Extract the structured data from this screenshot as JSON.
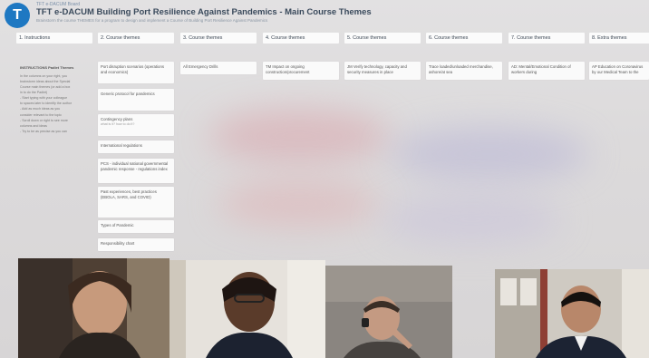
{
  "board": {
    "meta_line": "TFT e-DACUM Board",
    "title": "TFT e-DACUM Building Port Resilience Against Pandemics - Main Course Themes",
    "subtitle": "Brainstorm the course THEMES for a program to design and implement a Course of Building Port Resilience Against Pandemics"
  },
  "columns": [
    {
      "label": "1. Instructions"
    },
    {
      "label": "2. Course themes"
    },
    {
      "label": "3. Course themes"
    },
    {
      "label": "4. Course themes"
    },
    {
      "label": "5. Course themes"
    },
    {
      "label": "6. Course themes"
    },
    {
      "label": "7. Course themes"
    },
    {
      "label": "8. Extra themes"
    }
  ],
  "instructions": {
    "heading": "INSTRUCTIONS Padlet Themes",
    "lines": [
      "In the columns on your right, you",
      "brainstorm ideas about the Special",
      "Course main themes (or add a box",
      "in to do the Padlet)",
      "- Start typing with your colleague",
      "to spaces later to identify the author",
      "- Add as much ideas as you",
      "consider relevant to the topic",
      "- Scroll down or right to see more",
      "columns and ideas",
      "- Try to be as precise as you can"
    ]
  },
  "cards": {
    "col2": [
      {
        "text": "Port disruption scenarios (operations and economics)"
      },
      {
        "text": "Generic protocol for pandemics"
      },
      {
        "text": "Contingency plans",
        "small": "what is it? how to do it?"
      },
      {
        "text": "International regulations"
      },
      {
        "text": "PCS - individual national governmental pandemic response - regulations index"
      },
      {
        "text": "Past experiences, best practices (EBOLA, SARS, and COVID)"
      },
      {
        "text": "Types of Pandemic"
      },
      {
        "text": "Responsibility chart"
      }
    ],
    "col3": [
      {
        "text": "All Emergency Drills"
      }
    ],
    "col4": [
      {
        "text": "TM Impact on ongoing construction/procurement"
      }
    ],
    "col5": [
      {
        "text": "JM Verify technology, capacity and security measures in place"
      }
    ],
    "col6": [
      {
        "text": "Trace loaded/unloaded merchandise, ashore/at sea"
      }
    ],
    "col7": [
      {
        "text": "AD: Mental/Emotional Condition of workers during"
      }
    ],
    "col8": [
      {
        "text": "AP Education on Coronavirus by our Medical Team to the"
      }
    ]
  }
}
